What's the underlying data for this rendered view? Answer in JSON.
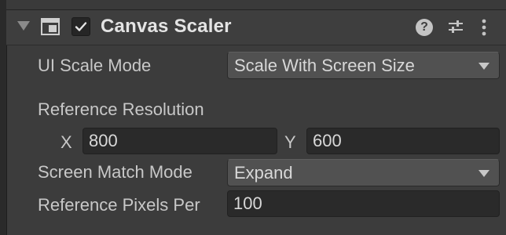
{
  "component": {
    "title": "Canvas Scaler",
    "enabled": true,
    "icons": {
      "foldout": "foldout-arrow-icon",
      "component": "canvas-scaler-component-icon",
      "help": "help-icon",
      "presets": "presets-sliders-icon",
      "menu": "kebab-menu-icon"
    },
    "help_glyph": "?"
  },
  "properties": {
    "ui_scale_mode": {
      "label": "UI Scale Mode",
      "value": "Scale With Screen Size"
    },
    "reference_resolution": {
      "label": "Reference Resolution",
      "x_label": "X",
      "x_value": "800",
      "y_label": "Y",
      "y_value": "600"
    },
    "screen_match_mode": {
      "label": "Screen Match Mode",
      "value": "Expand"
    },
    "reference_pixels_per_unit": {
      "label": "Reference Pixels Per",
      "value": "100"
    }
  },
  "colors": {
    "panel_bg": "#3c3c3c",
    "dropdown_bg": "#515151",
    "field_bg": "#2a2a2a",
    "text": "#d2d2d2"
  }
}
